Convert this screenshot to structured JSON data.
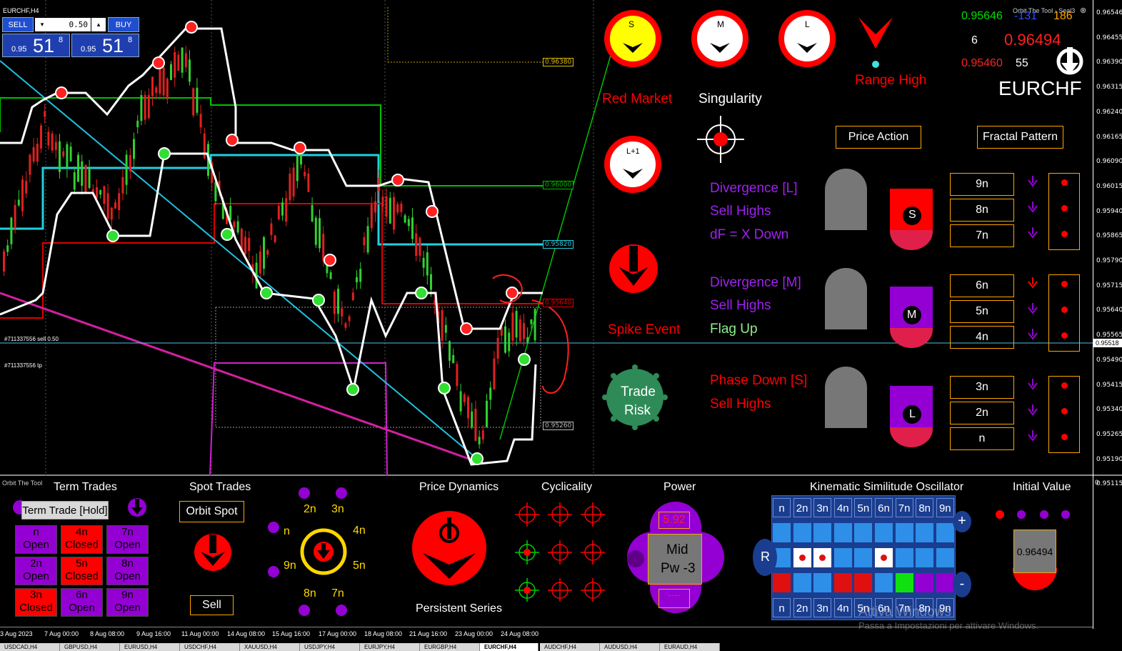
{
  "window": {
    "symbol_title": "EURCHF,H4"
  },
  "trade_panel": {
    "sell_label": "SELL",
    "buy_label": "BUY",
    "lot_value": "0.50",
    "sell_small": "0.95",
    "sell_big": "51",
    "sell_sup": "8",
    "buy_small": "0.95",
    "buy_big": "51",
    "buy_sup": "8"
  },
  "price_axis": {
    "ticks": [
      "0.96546",
      "0.96455",
      "0.96390",
      "0.96315",
      "0.96240",
      "0.96165",
      "0.96090",
      "0.96015",
      "0.95940",
      "0.95865",
      "0.95790",
      "0.95715",
      "0.95640",
      "0.95565",
      "0.95490",
      "0.95415",
      "0.95340",
      "0.95265",
      "0.95190",
      "0.95115"
    ],
    "current": "0.95518"
  },
  "price_lines": {
    "l1": "0.96380",
    "l2": "0.96000",
    "l3": "0.95820",
    "l4": "0.95640",
    "l5": "0.95260"
  },
  "order_labels": {
    "sell": "#711337556 sell 0.50",
    "tp": "#711337556 tp"
  },
  "header": {
    "orbit_title": "Orbit The Tool - Seal3",
    "price_green": "0.95646",
    "val_blue": "-131",
    "val_orange": "186",
    "count": "6",
    "price_red_big": "0.96494",
    "price_red_small": "0.95460",
    "count2": "55",
    "symbol": "EURCHF"
  },
  "signals": {
    "s_label": "S",
    "m_label": "M",
    "l_label": "L",
    "l1_label": "L+1",
    "red_market": "Red Market",
    "singularity": "Singularity",
    "range_high": "Range High",
    "spike_event": "Spike Event",
    "trade_risk_1": "Trade",
    "trade_risk_2": "Risk",
    "price_action": "Price Action",
    "fractal_pattern": "Fractal Pattern"
  },
  "divergence": {
    "l": [
      "Divergence [L]",
      "Sell Highs",
      "dF = X Down"
    ],
    "m": [
      "Divergence [M]",
      "Sell Highs",
      "Flag Up"
    ],
    "s": [
      "Phase Down [S]",
      "Sell Highs"
    ],
    "badges": [
      "S",
      "M",
      "L"
    ],
    "nboxes": [
      "9n",
      "8n",
      "7n",
      "6n",
      "5n",
      "4n",
      "3n",
      "2n",
      "n"
    ]
  },
  "bottom": {
    "orbit_tool": "Orbit The Tool",
    "term_trades_title": "Term Trades",
    "term_trade_button": "Term Trade [Hold]",
    "term_cells": [
      {
        "n": "n",
        "s": "Open",
        "c": "#9400d3"
      },
      {
        "n": "4n",
        "s": "Closed",
        "c": "#ff0000"
      },
      {
        "n": "7n",
        "s": "Open",
        "c": "#9400d3"
      },
      {
        "n": "2n",
        "s": "Open",
        "c": "#9400d3"
      },
      {
        "n": "5n",
        "s": "Closed",
        "c": "#ff0000"
      },
      {
        "n": "8n",
        "s": "Open",
        "c": "#9400d3"
      },
      {
        "n": "3n",
        "s": "Closed",
        "c": "#ff0000"
      },
      {
        "n": "6n",
        "s": "Open",
        "c": "#9400d3"
      },
      {
        "n": "9n",
        "s": "Open",
        "c": "#9400d3"
      }
    ],
    "spot_trades_title": "Spot Trades",
    "orbit_spot": "Orbit Spot",
    "sell": "Sell",
    "wheel": [
      "2n",
      "3n",
      "4n",
      "5n",
      "7n",
      "8n",
      "9n",
      "n"
    ],
    "price_dynamics_title": "Price Dynamics",
    "persistent_series": "Persistent Series",
    "cyclicality_title": "Cyclicality",
    "power_title": "Power",
    "power_value": "5.92",
    "power_mid": "Mid",
    "power_pw": "Pw -3",
    "power_dash": "----",
    "kso_title": "Kinematic Similitude Oscillator",
    "kso_headers": [
      "n",
      "2n",
      "3n",
      "4n",
      "5n",
      "6n",
      "7n",
      "8n",
      "9n"
    ],
    "kso_r": "R",
    "kso_plus": "+",
    "kso_minus": "-",
    "initial_value_title": "Initial Value",
    "initial_value": "0.96494",
    "watermark1": "Attiva Windows",
    "watermark2": "Passa a Impostazioni per attivare Windows."
  },
  "time_axis": [
    "3 Aug 2023",
    "7 Aug 00:00",
    "8 Aug 08:00",
    "9 Aug 16:00",
    "11 Aug 00:00",
    "14 Aug 08:00",
    "15 Aug 16:00",
    "17 Aug 00:00",
    "18 Aug 08:00",
    "21 Aug 16:00",
    "23 Aug 00:00",
    "24 Aug 08:00"
  ],
  "tabs": [
    "USDCAD,H4",
    "GBPUSD,H4",
    "EURUSD,H4",
    "USDCHF,H4",
    "XAUUSD,H4",
    "USDJPY,H4",
    "EURJPY,H4",
    "EURGBP,H4",
    "EURCHF,H4",
    "AUDCHF,H4",
    "AUDUSD,H4",
    "EURAUD,H4"
  ]
}
